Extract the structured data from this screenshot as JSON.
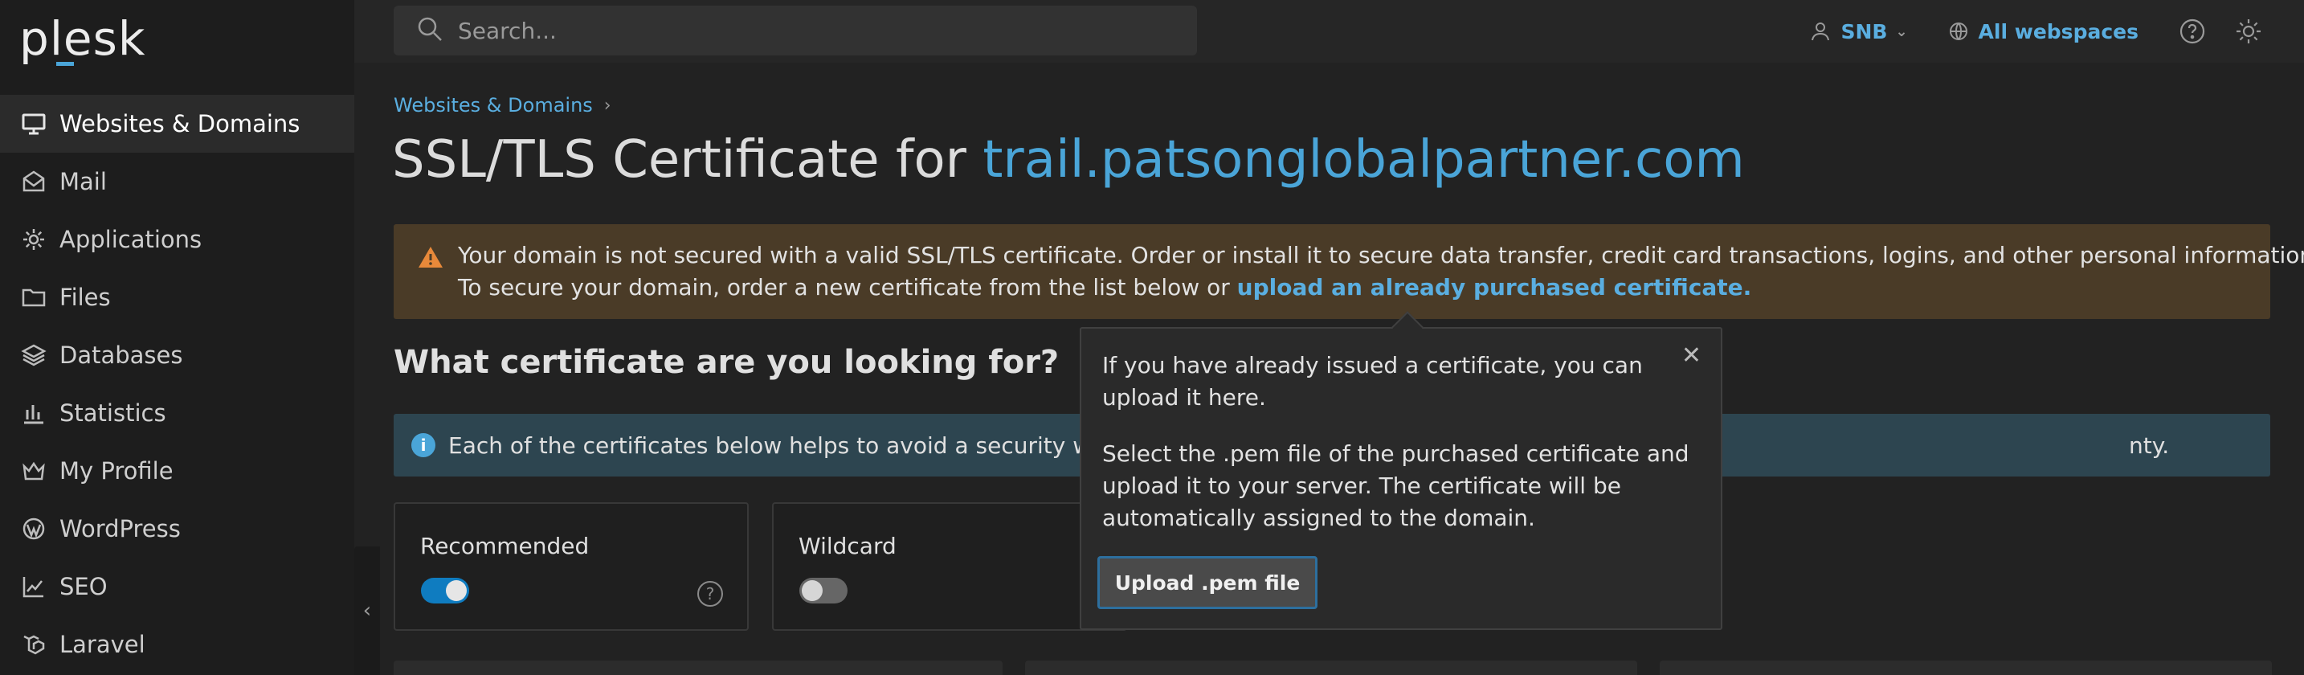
{
  "app": {
    "logo_text": "plesk"
  },
  "search": {
    "placeholder": "Search..."
  },
  "topbar": {
    "user_label": "SNB",
    "webspaces_label": "All webspaces"
  },
  "sidebar": {
    "items": [
      {
        "label": "Websites & Domains",
        "icon": "monitor-icon",
        "active": true
      },
      {
        "label": "Mail",
        "icon": "mail-icon"
      },
      {
        "label": "Applications",
        "icon": "gear-icon"
      },
      {
        "label": "Files",
        "icon": "folder-icon"
      },
      {
        "label": "Databases",
        "icon": "layers-icon"
      },
      {
        "label": "Statistics",
        "icon": "bar-chart-icon"
      },
      {
        "label": "My Profile",
        "icon": "crown-icon"
      },
      {
        "label": "WordPress",
        "icon": "wordpress-icon"
      },
      {
        "label": "SEO",
        "icon": "trend-chart-icon"
      },
      {
        "label": "Laravel",
        "icon": "laravel-icon"
      }
    ]
  },
  "breadcrumb": {
    "item": "Websites & Domains"
  },
  "page": {
    "title_prefix": "SSL/TLS Certificate for ",
    "title_domain": "trail.patsonglobalpartner.com"
  },
  "warning": {
    "line1": "Your domain is not secured with a valid SSL/TLS certificate. Order or install it to secure data transfer, credit card transactions, logins, and other personal information.",
    "line2_prefix": "To secure your domain, order a new certificate from the list below or ",
    "line2_link": "upload an already purchased certificate."
  },
  "section": {
    "question": "What certificate are you looking for?"
  },
  "info": {
    "text_left": "Each of the certificates below helps to avoid a security warni",
    "text_right": "nty."
  },
  "filters": [
    {
      "label": "Recommended",
      "enabled": true
    },
    {
      "label": "Wildcard",
      "enabled": false
    }
  ],
  "popover": {
    "text1": "If you have already issued a certificate, you can upload it here.",
    "text2": "Select the .pem file of the purchased certificate and upload it to your server. The certificate will be automatically assigned to the domain.",
    "button": "Upload .pem file"
  },
  "colors": {
    "accent": "#4aa5d8",
    "warning_bg": "#4a3b27",
    "warning_icon": "#e8893a",
    "info_bg": "#2d4550",
    "toggle_on": "#0f7cc0"
  }
}
